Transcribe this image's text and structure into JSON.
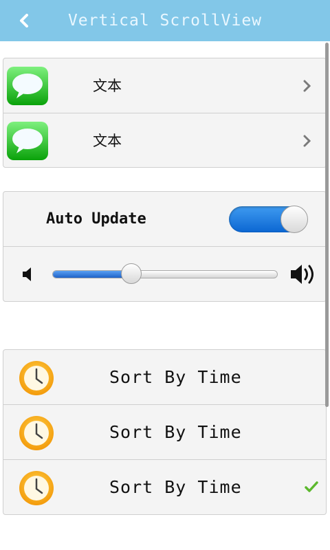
{
  "header": {
    "title": "Vertical ScrollView",
    "back_icon": "chevron-left-icon"
  },
  "list_group_1": {
    "items": [
      {
        "label": "文本",
        "icon": "message-bubble-icon"
      },
      {
        "label": "文本",
        "icon": "message-bubble-icon"
      }
    ]
  },
  "settings_group": {
    "auto_update_label": "Auto Update",
    "auto_update_on": true,
    "volume_level": 0.35
  },
  "sort_group": {
    "items": [
      {
        "label": "Sort By Time",
        "icon": "clock-icon",
        "checked": false
      },
      {
        "label": "Sort By Time",
        "icon": "clock-icon",
        "checked": false
      },
      {
        "label": "Sort By Time",
        "icon": "clock-icon",
        "checked": true
      }
    ]
  },
  "colors": {
    "header_bg": "#82c7e8",
    "accent_blue": "#1f6fd6",
    "check_green": "#5cb82e"
  }
}
